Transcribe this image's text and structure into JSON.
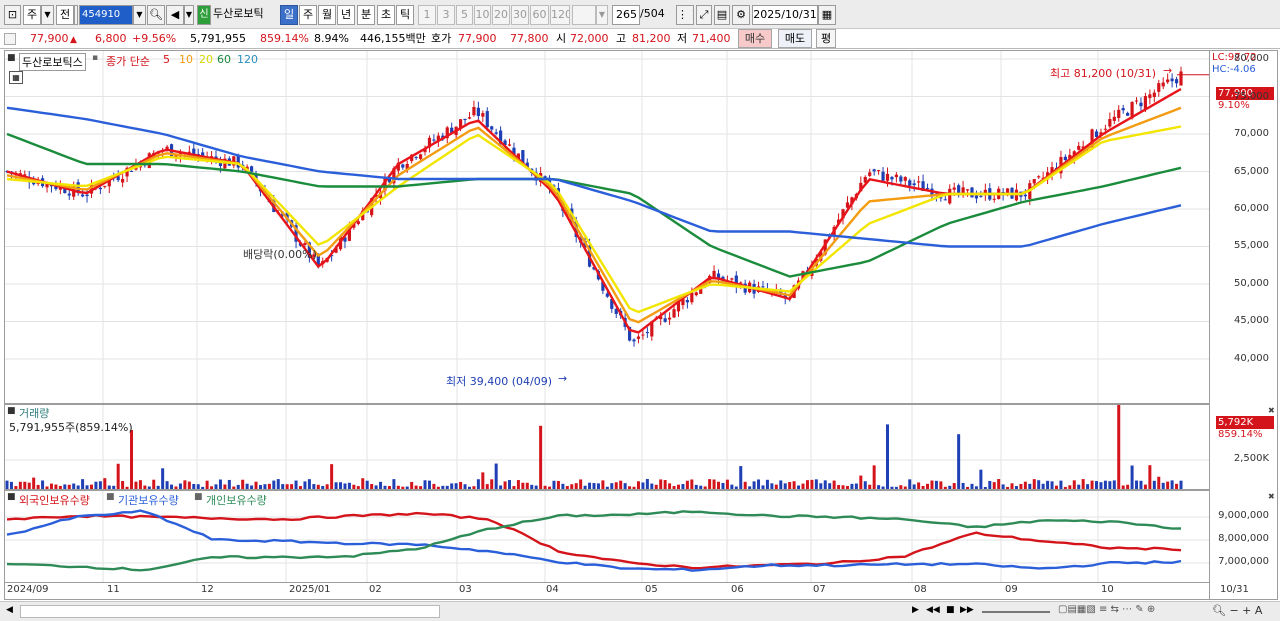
{
  "toolbar": {
    "market": "주",
    "prev": "전",
    "code": "454910",
    "stock_name": "두산로보틱",
    "periods": [
      "일",
      "주",
      "월",
      "년",
      "분",
      "초",
      "틱"
    ],
    "minutes": [
      "1",
      "3",
      "5",
      "10",
      "20",
      "30",
      "60",
      "120"
    ],
    "count": "265",
    "count_total": "/504",
    "date": "2025/10/31"
  },
  "quote": {
    "price": "77,900",
    "change": "6,800",
    "change_pct": "+9.56%",
    "volume": "5,791,955",
    "vol_ratio": "859.14%",
    "turnover": "8.94%",
    "amount": "446,155백만",
    "bid_label": "호가",
    "ask": "77,900",
    "bid": "77,800",
    "open_label": "시",
    "open": "72,000",
    "high_label": "고",
    "high": "81,200",
    "low_label": "저",
    "low": "71,400",
    "buy_btn": "매수",
    "sell_btn": "매도",
    "eval_btn": "평"
  },
  "price_panel": {
    "title": "두산로보틱스",
    "legend_prefix": "종가 단순",
    "ma_labels": [
      "5",
      "10",
      "20",
      "60",
      "120"
    ],
    "ma_colors": [
      "#e8141b",
      "#f39c12",
      "#e6e600",
      "#1a8c3c",
      "#2b5fd9"
    ],
    "dividend_note": "배당락(0.00%)",
    "high_note": "최고 81,200 (10/31)",
    "low_note": "최저 39,400 (04/09)",
    "lc": "LC:97.72",
    "hc": "HC:-4.06",
    "last_price": "77,900",
    "last_pct": "9.10%",
    "y_ticks": [
      "80,000",
      "75,000",
      "70,000",
      "65,000",
      "60,000",
      "55,000",
      "50,000",
      "45,000",
      "40,000"
    ]
  },
  "volume_panel": {
    "title": "거래량",
    "value": "5,791,955주(859.14%)",
    "last": "5,792K",
    "last_pct": "859.14%",
    "y_tick": "2,500K"
  },
  "holdings_panel": {
    "series": [
      "외국인보유수량",
      "기관보유수량",
      "개인보유수량"
    ],
    "series_colors": [
      "#d4141b",
      "#2b5fd9",
      "#2e8b57"
    ],
    "y_ticks": [
      "9,000,000",
      "8,000,000",
      "7,000,000"
    ]
  },
  "x_axis": {
    "labels": [
      "2024/09",
      "11",
      "12",
      "2025/01",
      "02",
      "03",
      "04",
      "05",
      "06",
      "07",
      "08",
      "09",
      "10"
    ],
    "right_label": "10/31"
  },
  "chart_data": {
    "type": "line",
    "title": "두산로보틱스",
    "high": {
      "value": 81200,
      "date": "10/31"
    },
    "low": {
      "value": 39400,
      "date": "04/09"
    },
    "last_close": 77900,
    "ylim": [
      37000,
      82000
    ],
    "x": [
      "2024/09",
      "11",
      "12",
      "2025/01",
      "02",
      "03",
      "04",
      "05",
      "06",
      "07",
      "08",
      "09",
      "10",
      "10/31"
    ],
    "series": [
      {
        "name": "종가",
        "values": [
          65000,
          62000,
          68000,
          66000,
          52000,
          66000,
          73000,
          62000,
          42000,
          51000,
          48000,
          65000,
          62000,
          62000,
          71000,
          77900
        ]
      },
      {
        "name": "5",
        "values": [
          65000,
          62000,
          68000,
          66000,
          52000,
          66000,
          72000,
          62000,
          43000,
          51000,
          48000,
          64000,
          62000,
          62000,
          70000,
          76000
        ]
      },
      {
        "name": "20",
        "values": [
          64000,
          63000,
          67000,
          66000,
          55000,
          63000,
          70000,
          63000,
          46000,
          50000,
          49000,
          58000,
          62000,
          62000,
          69000,
          71000
        ]
      },
      {
        "name": "60",
        "values": [
          70000,
          66000,
          66000,
          65000,
          63000,
          63000,
          64000,
          64000,
          62000,
          55000,
          51000,
          53000,
          58000,
          61000,
          63000,
          65500
        ]
      },
      {
        "name": "120",
        "values": [
          73500,
          72000,
          70000,
          67000,
          65000,
          64000,
          64000,
          64000,
          61000,
          57000,
          57000,
          56000,
          55000,
          55000,
          58000,
          60500
        ]
      }
    ]
  }
}
